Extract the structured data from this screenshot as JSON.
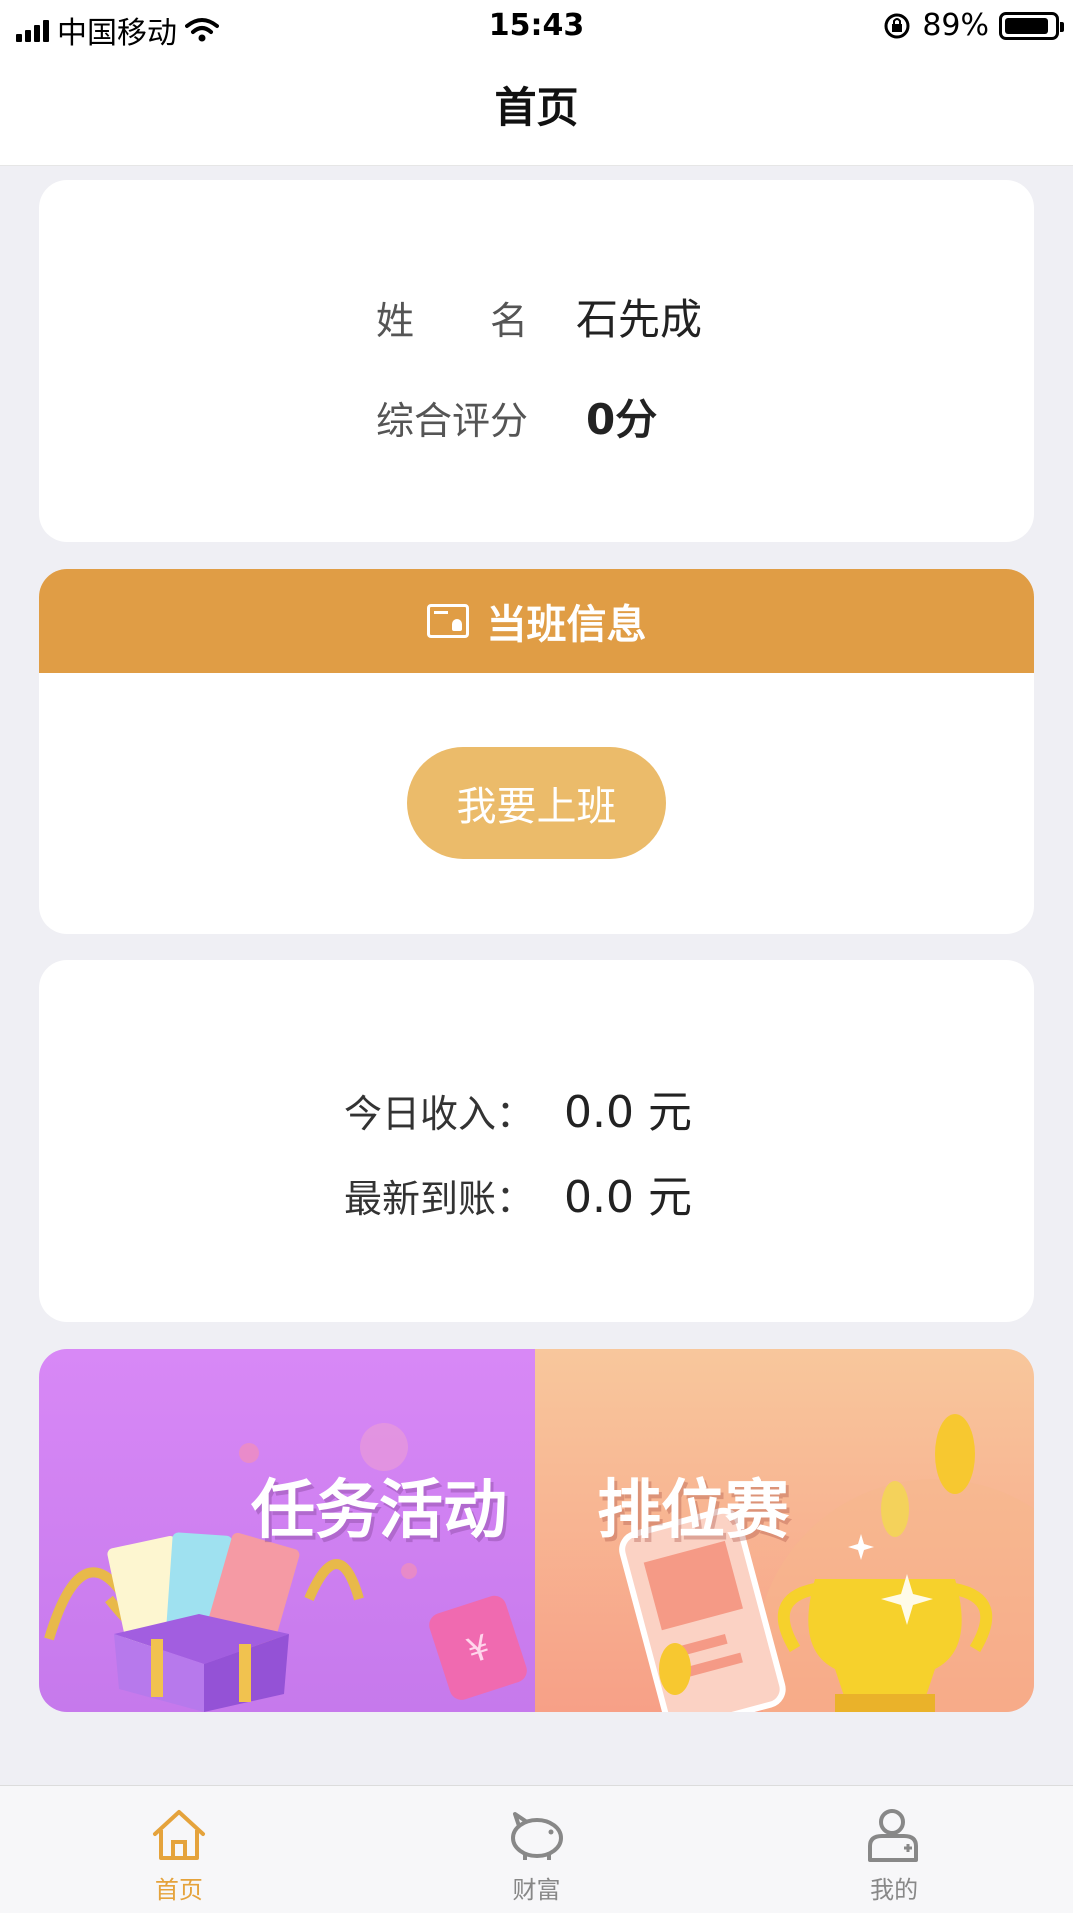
{
  "status_bar": {
    "carrier": "中国移动",
    "time": "15:43",
    "battery_percent": "89%",
    "battery_level": 0.89
  },
  "nav": {
    "title": "首页"
  },
  "profile": {
    "name_label": "姓　　名",
    "name_value": "石先成",
    "score_label": "综合评分",
    "score_value": "0分"
  },
  "shift": {
    "header": "当班信息",
    "icon": "shift-badge-icon",
    "button": "我要上班"
  },
  "income": {
    "today_label": "今日收入：",
    "today_value": "0.0 元",
    "latest_label": "最新到账：",
    "latest_value": "0.0 元"
  },
  "banners": {
    "task": "任务活动",
    "rank": "排位赛"
  },
  "tabs": [
    {
      "label": "首页",
      "icon": "home-icon",
      "active": true
    },
    {
      "label": "财富",
      "icon": "piggy-bank-icon",
      "active": false
    },
    {
      "label": "我的",
      "icon": "user-icon",
      "active": false
    }
  ],
  "colors": {
    "accent": "#e09d45",
    "button": "#ebbb6a",
    "task_banner": "#d888f6",
    "rank_banner": "#f7a087",
    "active_tab": "#e5a33c"
  }
}
